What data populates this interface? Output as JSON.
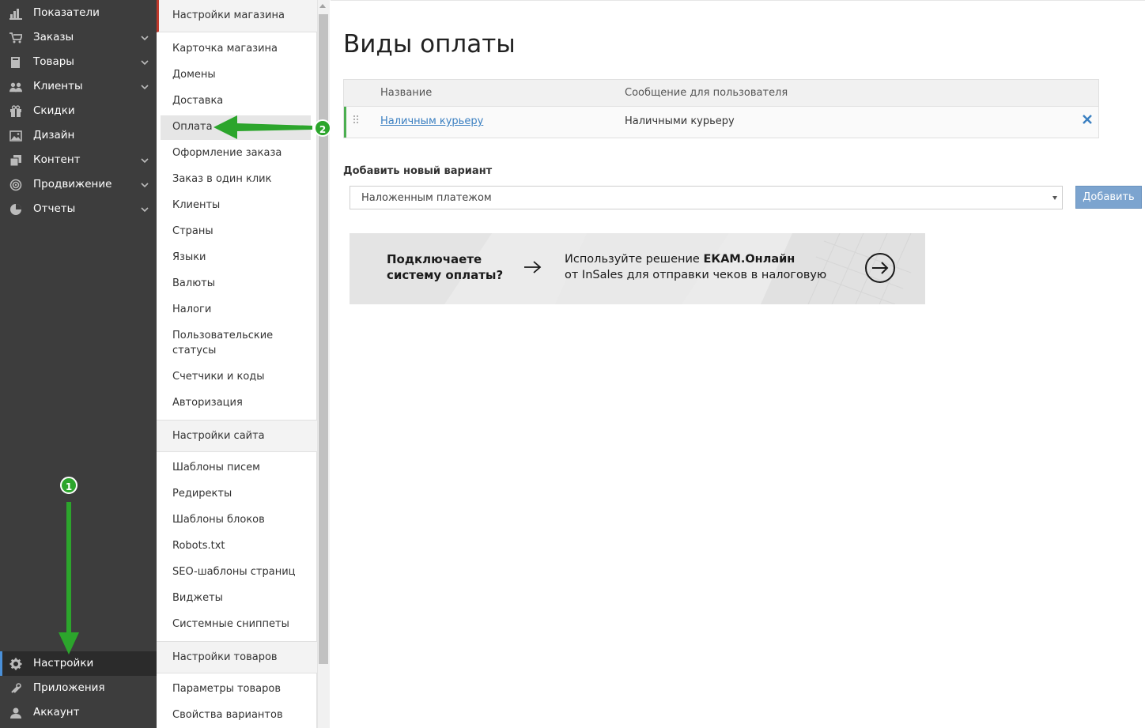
{
  "sidebar": {
    "items": [
      {
        "label": "Показатели",
        "icon": "bar-chart-icon",
        "has_chevron": false
      },
      {
        "label": "Заказы",
        "icon": "cart-icon",
        "has_chevron": true
      },
      {
        "label": "Товары",
        "icon": "book-icon",
        "has_chevron": true
      },
      {
        "label": "Клиенты",
        "icon": "users-icon",
        "has_chevron": true
      },
      {
        "label": "Скидки",
        "icon": "gift-icon",
        "has_chevron": false
      },
      {
        "label": "Дизайн",
        "icon": "image-icon",
        "has_chevron": false
      },
      {
        "label": "Контент",
        "icon": "pages-icon",
        "has_chevron": true
      },
      {
        "label": "Продвижение",
        "icon": "target-icon",
        "has_chevron": true
      },
      {
        "label": "Отчеты",
        "icon": "pie-chart-icon",
        "has_chevron": true
      }
    ],
    "bottom_items": [
      {
        "label": "Настройки",
        "icon": "gear-icon",
        "active": true
      },
      {
        "label": "Приложения",
        "icon": "puzzle-icon",
        "active": false
      },
      {
        "label": "Аккаунт",
        "icon": "user-icon",
        "active": false
      }
    ]
  },
  "settings_menu": {
    "store_header": "Настройки магазина",
    "store_items": [
      "Карточка магазина",
      "Домены",
      "Доставка",
      "Оплата",
      "Оформление заказа",
      "Заказ в один клик",
      "Клиенты",
      "Страны",
      "Языки",
      "Валюты",
      "Налоги",
      "Пользовательские статусы",
      "Счетчики и коды",
      "Авторизация"
    ],
    "selected": "Оплата",
    "site_header": "Настройки сайта",
    "site_items": [
      "Шаблоны писем",
      "Редиректы",
      "Шаблоны блоков",
      "Robots.txt",
      "SEO-шаблоны страниц",
      "Виджеты",
      "Системные сниппеты"
    ],
    "products_header": "Настройки товаров",
    "products_items": [
      "Параметры товаров",
      "Свойства вариантов"
    ]
  },
  "main": {
    "title": "Виды оплаты",
    "table": {
      "columns": [
        "Название",
        "Сообщение для пользователя"
      ],
      "rows": [
        {
          "name": "Наличным курьеру",
          "message": "Наличными курьеру"
        }
      ]
    },
    "add_label": "Добавить новый вариант",
    "select_value": "Наложенным платежом",
    "add_button": "Добавить",
    "banner": {
      "question": "Подключаете систему оплаты?",
      "text_prefix": "Используйте решение ",
      "text_bold": "ЕКАМ.Онлайн",
      "text_suffix": "от InSales для отправки чеков в налоговую"
    }
  },
  "annotations": {
    "step1": "1",
    "step2": "2",
    "arrow_color": "#2ca52c"
  },
  "colors": {
    "sidebar_bg": "#3d3d3d",
    "accent_blue": "#3a7fc1",
    "button_blue": "#7ca4cf",
    "row_marker_green": "#4caf50"
  }
}
